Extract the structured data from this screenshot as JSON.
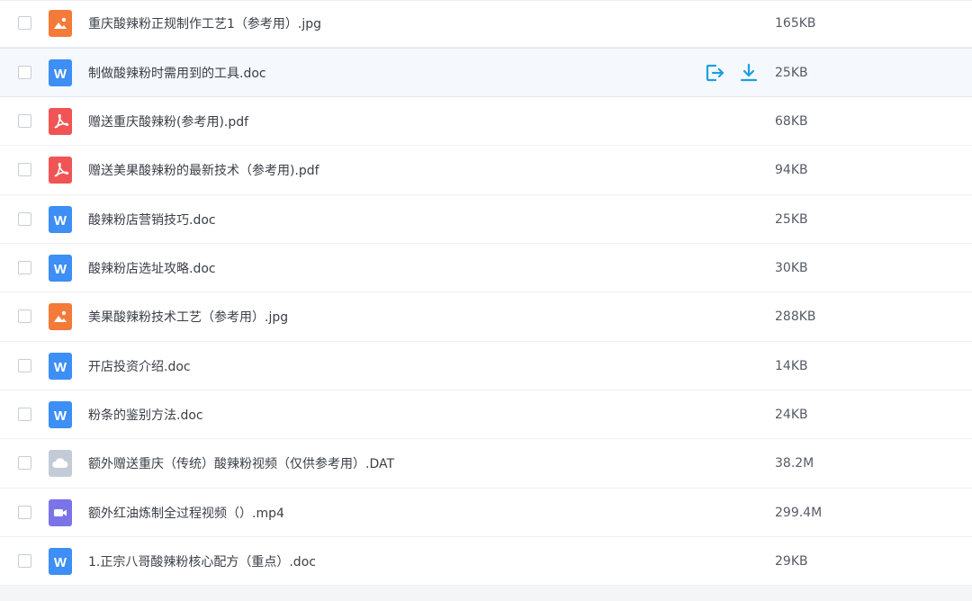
{
  "accent": "#1aa0e0",
  "files": [
    {
      "name": "重庆酸辣粉正规制作工艺1（参考用）.jpg",
      "size": "165KB",
      "type": "image",
      "icon": "image-file-icon"
    },
    {
      "name": "制做酸辣粉时需用到的工具.doc",
      "size": "25KB",
      "type": "doc",
      "icon": "word-doc-icon",
      "hovered": true
    },
    {
      "name": "赠送重庆酸辣粉(参考用).pdf",
      "size": "68KB",
      "type": "pdf",
      "icon": "pdf-file-icon"
    },
    {
      "name": "赠送美果酸辣粉的最新技术（参考用).pdf",
      "size": "94KB",
      "type": "pdf",
      "icon": "pdf-file-icon"
    },
    {
      "name": "酸辣粉店营销技巧.doc",
      "size": "25KB",
      "type": "doc",
      "icon": "word-doc-icon"
    },
    {
      "name": "酸辣粉店选址攻略.doc",
      "size": "30KB",
      "type": "doc",
      "icon": "word-doc-icon"
    },
    {
      "name": "美果酸辣粉技术工艺（参考用）.jpg",
      "size": "288KB",
      "type": "image",
      "icon": "image-file-icon"
    },
    {
      "name": "开店投资介绍.doc",
      "size": "14KB",
      "type": "doc",
      "icon": "word-doc-icon"
    },
    {
      "name": "粉条的鉴别方法.doc",
      "size": "24KB",
      "type": "doc",
      "icon": "word-doc-icon"
    },
    {
      "name": "额外赠送重庆（传统）酸辣粉视频（仅供参考用）.DAT",
      "size": "38.2M",
      "type": "other",
      "icon": "cloud-file-icon"
    },
    {
      "name": "额外红油炼制全过程视频（）.mp4",
      "size": "299.4M",
      "type": "video",
      "icon": "video-file-icon"
    },
    {
      "name": "1.正宗八哥酸辣粉核心配方（重点）.doc",
      "size": "29KB",
      "type": "doc",
      "icon": "word-doc-icon"
    }
  ]
}
